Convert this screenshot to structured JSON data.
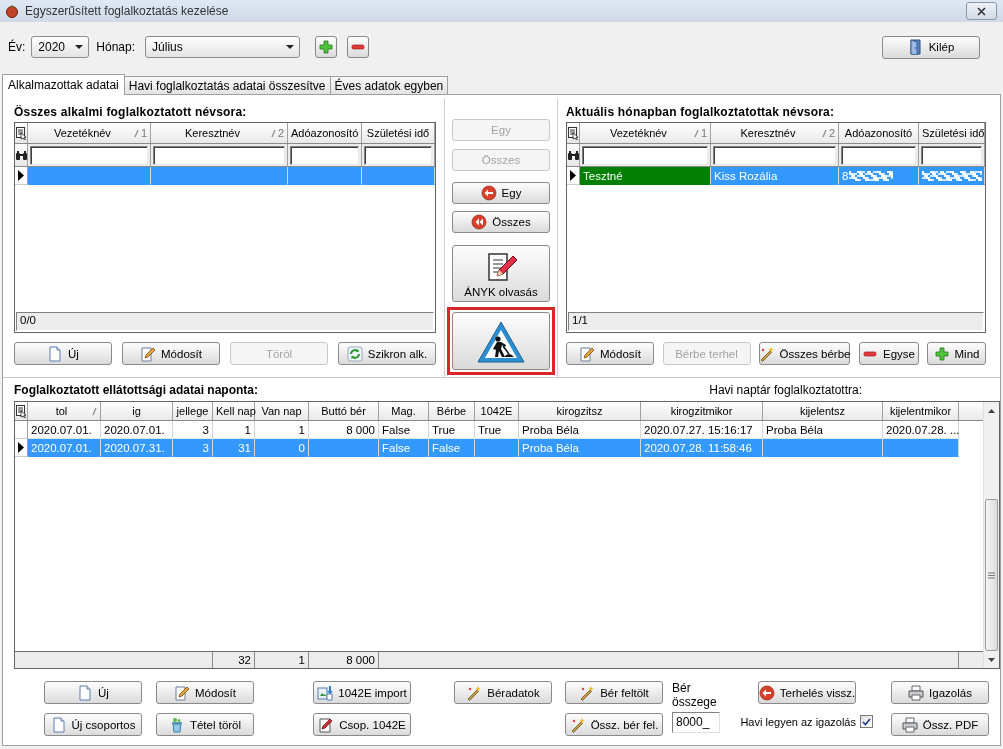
{
  "window": {
    "title": "Egyszerűsített foglalkoztatás kezelése"
  },
  "toolbar": {
    "year_label": "Év:",
    "year": "2020",
    "month_label": "Hónap:",
    "month": "Július",
    "exit_button": "Kilép"
  },
  "tabs": [
    {
      "label": "Alkalmazottak adatai",
      "selected": true
    },
    {
      "label": "Havi foglalkoztatás adatai összesítve",
      "selected": false
    },
    {
      "label": "Éves adatok egyben",
      "selected": false
    }
  ],
  "left_panel": {
    "title": "Összes alkalmi foglalkoztatott névsora:",
    "columns": [
      {
        "label": "Vezetéknév",
        "sort_index": "1"
      },
      {
        "label": "Keresztnév",
        "sort_index": "2"
      },
      {
        "label": "Adóazonosító"
      },
      {
        "label": "Születési idő"
      }
    ],
    "rows": [
      {
        "selected": true,
        "cells": [
          null,
          null,
          null,
          null
        ]
      }
    ],
    "footer": "0/0",
    "buttons": [
      {
        "label": "Új",
        "kind": "new",
        "disabled": false
      },
      {
        "label": "Módosít",
        "kind": "edit",
        "disabled": false
      },
      {
        "label": "Töröl",
        "kind": "plain",
        "disabled": true
      },
      {
        "label": "Szikron alk.",
        "kind": "sync",
        "disabled": false
      }
    ]
  },
  "transfer_buttons": [
    {
      "kind": "plain",
      "label": "Egy",
      "disabled": true,
      "highlighted": false
    },
    {
      "kind": "plain",
      "label": "Összes",
      "disabled": true,
      "highlighted": false
    },
    {
      "kind": "back",
      "label": "Egy",
      "disabled": false,
      "highlighted": false
    },
    {
      "kind": "back-all",
      "label": "Összes",
      "disabled": false,
      "highlighted": false
    },
    {
      "kind": "read",
      "label": "ÁNYK olvasás",
      "disabled": false,
      "highlighted": false
    },
    {
      "kind": "roadwork",
      "disabled": false,
      "highlighted": true
    }
  ],
  "right_panel": {
    "title": "Aktuális hónapban foglalkoztatottak névsora:",
    "columns": [
      {
        "label": "Vezetéknév",
        "sort_index": "1"
      },
      {
        "label": "Keresztnév",
        "sort_index": "2"
      },
      {
        "label": "Adóazonosító"
      },
      {
        "label": "Születési idő"
      }
    ],
    "rows": [
      {
        "selected": true,
        "color": "#007f00",
        "redacted": true,
        "cells": [
          "Tesztné",
          "Kiss Rozália",
          "8",
          null
        ]
      }
    ],
    "footer": "1/1",
    "buttons": [
      {
        "label": "Módosít",
        "kind": "edit",
        "disabled": false
      },
      {
        "label": "Bérbe terhel",
        "kind": "plain",
        "disabled": true
      },
      {
        "label": "Összes bérbe",
        "kind": "wand",
        "disabled": false
      },
      {
        "label": "Egyse",
        "kind": "remove",
        "disabled": false
      },
      {
        "label": "Mind",
        "kind": "add",
        "disabled": false
      }
    ]
  },
  "daily": {
    "title": "Foglalkoztatott ellátottsági adatai naponta:",
    "calendar_label": "Havi naptár foglalkoztatottra:",
    "columns": [
      {
        "label": "tol",
        "kind": "text",
        "sorted": true
      },
      {
        "label": "ig",
        "kind": "text",
        "sorted": false
      },
      {
        "label": "jellege",
        "kind": "num",
        "sorted": false
      },
      {
        "label": "Kell nap",
        "kind": "num",
        "sorted": false
      },
      {
        "label": "Van nap",
        "kind": "num",
        "sorted": false
      },
      {
        "label": "Buttó bér",
        "kind": "num",
        "sorted": false
      },
      {
        "label": "Mag.",
        "kind": "text",
        "sorted": false
      },
      {
        "label": "Bérbe",
        "kind": "text",
        "sorted": false
      },
      {
        "label": "1042E",
        "kind": "text",
        "sorted": false
      },
      {
        "label": "kirogzitsz",
        "kind": "text",
        "sorted": false
      },
      {
        "label": "kirogzitmikor",
        "kind": "text",
        "sorted": false
      },
      {
        "label": "kijelentsz",
        "kind": "text",
        "sorted": false
      },
      {
        "label": "kijelentmikor",
        "kind": "text",
        "sorted": false
      }
    ],
    "rows": [
      {
        "selected": false,
        "cells": [
          "2020.07.01.",
          "2020.07.01.",
          "3",
          "1",
          "1",
          "8 000",
          "False",
          "True",
          "True",
          "Proba Béla",
          "2020.07.27. 15:16:17",
          "Proba Béla",
          "2020.07.28. ..."
        ]
      },
      {
        "selected": true,
        "cells": [
          "2020.07.01.",
          "2020.07.31.",
          "3",
          "31",
          "0",
          null,
          "False",
          "False",
          null,
          "Proba Béla",
          "2020.07.28. 11:58:46",
          null,
          null
        ]
      }
    ],
    "totals": [
      "32",
      "1",
      "8 000"
    ]
  },
  "bottom": {
    "button_columns": [
      [
        {
          "label": "Új",
          "kind": "new"
        },
        {
          "label": "Új csoportos",
          "kind": "new"
        }
      ],
      [
        {
          "label": "Módosít",
          "kind": "edit"
        },
        {
          "label": "Tétel töröl",
          "kind": "delete"
        }
      ],
      [
        {
          "label": "1042E import",
          "kind": "import"
        },
        {
          "label": "Csop. 1042E",
          "kind": "group"
        }
      ],
      [
        {
          "label": "Béradatok",
          "kind": "wand"
        }
      ],
      [
        {
          "label": "Bér feltölt",
          "kind": "wand"
        },
        {
          "label": "Össz. bér fel.",
          "kind": "wand"
        }
      ]
    ],
    "wage": {
      "label": "Bér összege",
      "value": "8000_"
    },
    "reverse_button": {
      "label": "Terhelés vissz.",
      "kind": "back"
    },
    "certificate_checkbox": {
      "label": "Havi legyen az igazolás",
      "checked": true
    },
    "print_buttons": [
      {
        "label": "Igazolás",
        "kind": "print"
      },
      {
        "label": "Össz. PDF",
        "kind": "print"
      }
    ]
  }
}
